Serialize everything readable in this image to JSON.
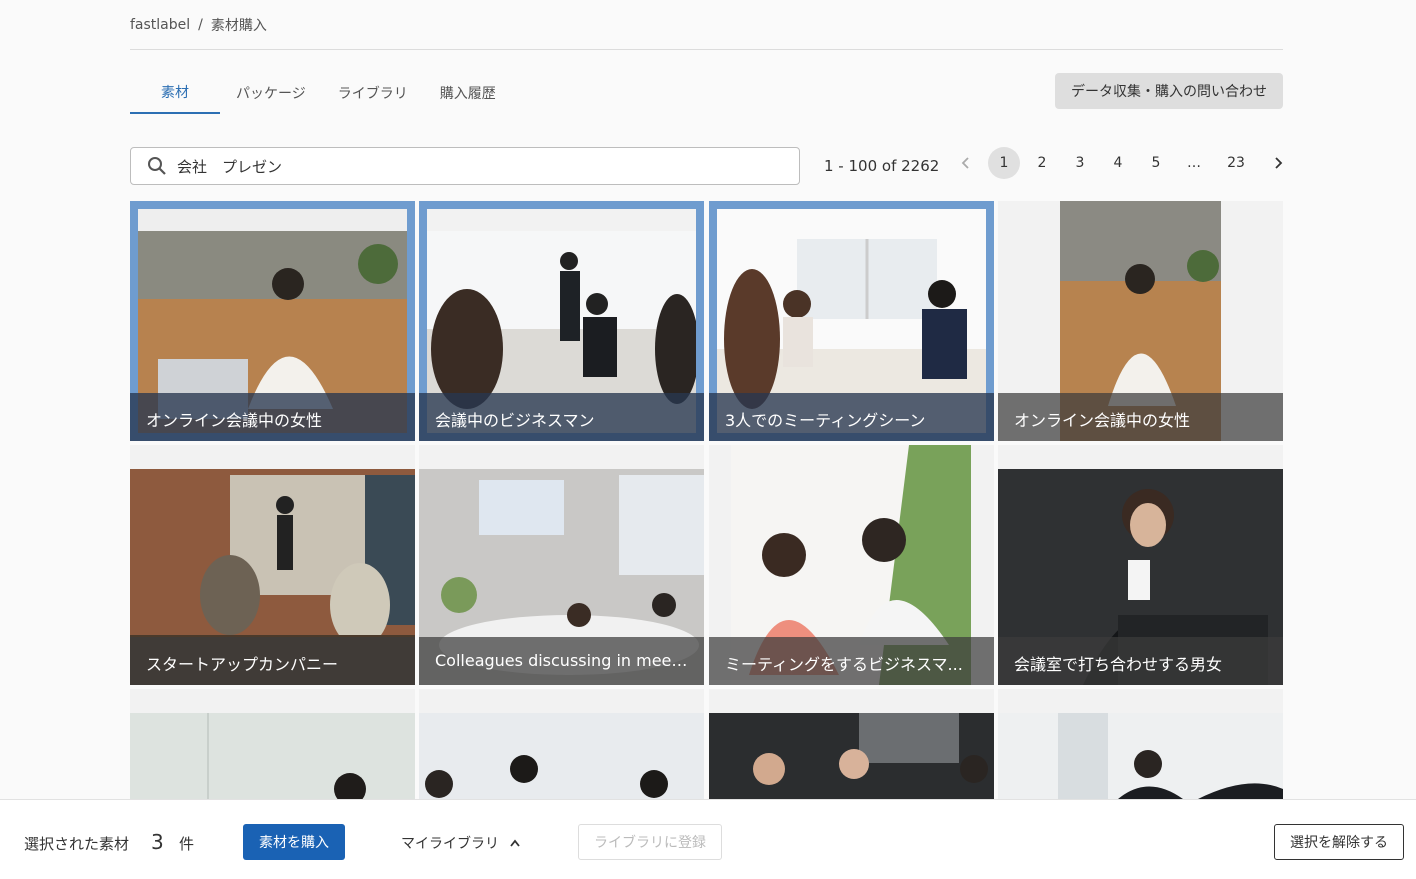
{
  "breadcrumb": {
    "root": "fastlabel",
    "separator": "/",
    "current": "素材購入"
  },
  "tabs": [
    {
      "label": "素材",
      "active": true
    },
    {
      "label": "パッケージ",
      "active": false
    },
    {
      "label": "ライブラリ",
      "active": false
    },
    {
      "label": "購入履歴",
      "active": false
    }
  ],
  "inquiry_button": "データ収集・購入の問い合わせ",
  "search": {
    "value": "会社　プレゼン",
    "icon": "search-icon"
  },
  "results_range": "1 - 100 of 2262",
  "pagination": {
    "prev_icon": "chevron-left-icon",
    "pages": [
      "1",
      "2",
      "3",
      "4",
      "5",
      "…",
      "23"
    ],
    "current": "1",
    "next_icon": "chevron-right-icon"
  },
  "cards": [
    {
      "caption": "オンライン会議中の女性",
      "selected": true
    },
    {
      "caption": "会議中のビジネスマン",
      "selected": true
    },
    {
      "caption": "3人でのミーティングシーン",
      "selected": true
    },
    {
      "caption": "オンライン会議中の女性",
      "selected": false
    },
    {
      "caption": "スタートアップカンパニー",
      "selected": false
    },
    {
      "caption": "Colleagues discussing in meetin...",
      "selected": false
    },
    {
      "caption": "ミーティングをするビジネスマ...",
      "selected": false
    },
    {
      "caption": "会議室で打ち合わせする男女",
      "selected": false
    },
    {
      "caption": "",
      "selected": false
    },
    {
      "caption": "",
      "selected": false
    },
    {
      "caption": "",
      "selected": false
    },
    {
      "caption": "",
      "selected": false
    }
  ],
  "footer": {
    "selected_label": "選択された素材",
    "selected_count": "3",
    "unit": "件",
    "buy_button": "素材を購入",
    "my_library": "マイライブラリ",
    "register_button": "ライブラリに登録",
    "clear_button": "選択を解除する"
  },
  "colors": {
    "accent": "#1a62b4",
    "selected_border": "#6f9ccf"
  }
}
